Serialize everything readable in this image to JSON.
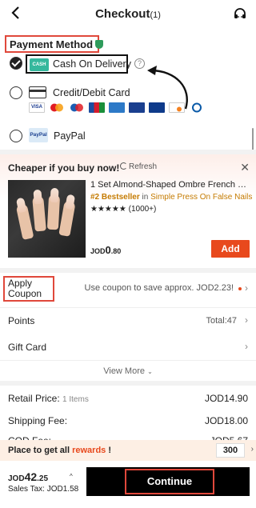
{
  "header": {
    "title": "Checkout",
    "count": "(1)"
  },
  "payment": {
    "section_title": "Payment Method",
    "cod": {
      "icon_text": "CASH",
      "label": "Cash On Delivery",
      "help": "?"
    },
    "card": {
      "label": "Credit/Debit Card",
      "brands": [
        "VISA",
        "Mastercard",
        "Maestro",
        "JCB",
        "American Express",
        "Mada",
        "Diners",
        "Discover",
        "Diners Club"
      ]
    },
    "paypal": {
      "icon_text": "PayPal",
      "label": "PayPal"
    }
  },
  "cheaper": {
    "title": "Cheaper if you buy now!",
    "refresh": "Refresh",
    "close": "✕",
    "product_name": "1 Set Almond-Shaped Ombre French Mi...",
    "rank": "#2 Bestseller",
    "rank_in": "in",
    "category": "Simple Press On False Nails",
    "stars": "★★★★★",
    "reviews": "(1000+)",
    "currency": "JOD",
    "price": "0",
    "price_dec": ".80",
    "add_label": "Add"
  },
  "coupon": {
    "label": "Apply Coupon",
    "text": "Use coupon to save approx. JOD2.23!"
  },
  "points": {
    "label": "Points",
    "value": "Total:47"
  },
  "gift_card": {
    "label": "Gift Card"
  },
  "view_more": "View More",
  "summary": {
    "retail_label": "Retail Price:",
    "retail_items": "1 Items",
    "retail_value": "JOD14.90",
    "shipping_label": "Shipping Fee:",
    "shipping_value": "JOD18.00",
    "cod_label": "COD Fee:",
    "cod_value": "JOD5.67"
  },
  "rewards": {
    "prefix": "Place to get all",
    "highlight": "rewards",
    "suffix": "!",
    "points": "300"
  },
  "bottom": {
    "currency": "JOD",
    "total": "42",
    "total_dec": ".25",
    "tax": "Sales Tax: JOD1.58",
    "continue_label": "Continue"
  },
  "colors": {
    "accent": "#e8491d",
    "annotation_red": "#e0483b",
    "cod_green": "#35b89d"
  }
}
